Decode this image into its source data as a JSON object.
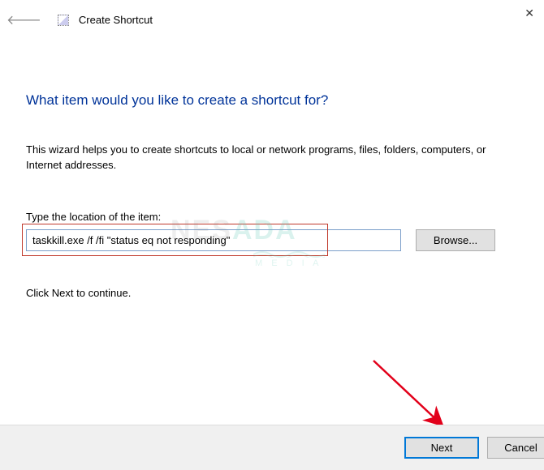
{
  "window": {
    "title": "Create Shortcut"
  },
  "main": {
    "heading": "What item would you like to create a shortcut for?",
    "description": "This wizard helps you to create shortcuts to local or network programs, files, folders, computers, or Internet addresses.",
    "location_label": "Type the location of the item:",
    "location_value": "taskkill.exe /f /fi \"status eq not responding\"",
    "browse_label": "Browse...",
    "continue_text": "Click Next to continue."
  },
  "footer": {
    "next_label": "Next",
    "cancel_label": "Cancel"
  },
  "watermark": {
    "text": "NESADA",
    "sub": "M E D I A"
  }
}
